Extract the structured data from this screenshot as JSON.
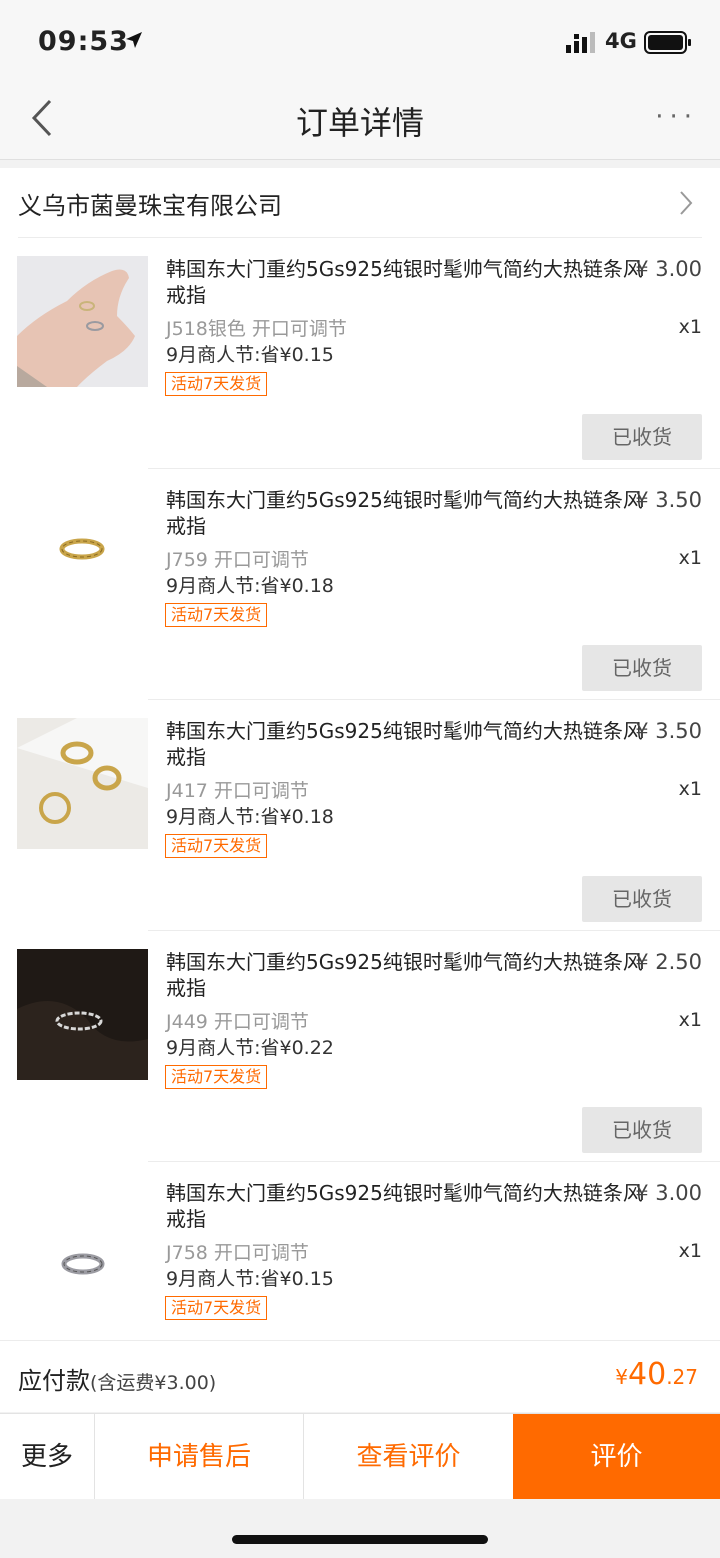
{
  "status": {
    "time": "09:53",
    "network": "4G"
  },
  "nav": {
    "title": "订单详情",
    "more": "···"
  },
  "shop": {
    "name": "义乌市菌曼珠宝有限公司"
  },
  "items": [
    {
      "title": "韩国东大门重约5Gs925纯银时髦帅气简约大热链条风戒指",
      "price": "¥ 3.00",
      "sku": "J518银色 开口可调节",
      "qty": "x1",
      "promo": "9月商人节:省¥0.15",
      "tag": "活动7天发货",
      "button": "已收货"
    },
    {
      "title": "韩国东大门重约5Gs925纯银时髦帅气简约大热链条风戒指",
      "price": "¥ 3.50",
      "sku": "J759 开口可调节",
      "qty": "x1",
      "promo": "9月商人节:省¥0.18",
      "tag": "活动7天发货",
      "button": "已收货"
    },
    {
      "title": "韩国东大门重约5Gs925纯银时髦帅气简约大热链条风戒指",
      "price": "¥ 3.50",
      "sku": "J417 开口可调节",
      "qty": "x1",
      "promo": "9月商人节:省¥0.18",
      "tag": "活动7天发货",
      "button": "已收货"
    },
    {
      "title": "韩国东大门重约5Gs925纯银时髦帅气简约大热链条风戒指",
      "price": "¥ 2.50",
      "sku": "J449 开口可调节",
      "qty": "x1",
      "promo": "9月商人节:省¥0.22",
      "tag": "活动7天发货",
      "button": "已收货"
    },
    {
      "title": "韩国东大门重约5Gs925纯银时髦帅气简约大热链条风戒指",
      "price": "¥ 3.00",
      "sku": "J758 开口可调节",
      "qty": "x1",
      "promo": "9月商人节:省¥0.15",
      "tag": "活动7天发货"
    }
  ],
  "total": {
    "label": "应付款",
    "shipping": "(含运费¥3.00)",
    "currency": "¥",
    "amount_int": "40",
    "amount_dec": ".27"
  },
  "actions": {
    "more": "更多",
    "after_sales": "申请售后",
    "view_review": "查看评价",
    "review": "评价"
  },
  "colors": {
    "accent": "#ff6a00"
  }
}
